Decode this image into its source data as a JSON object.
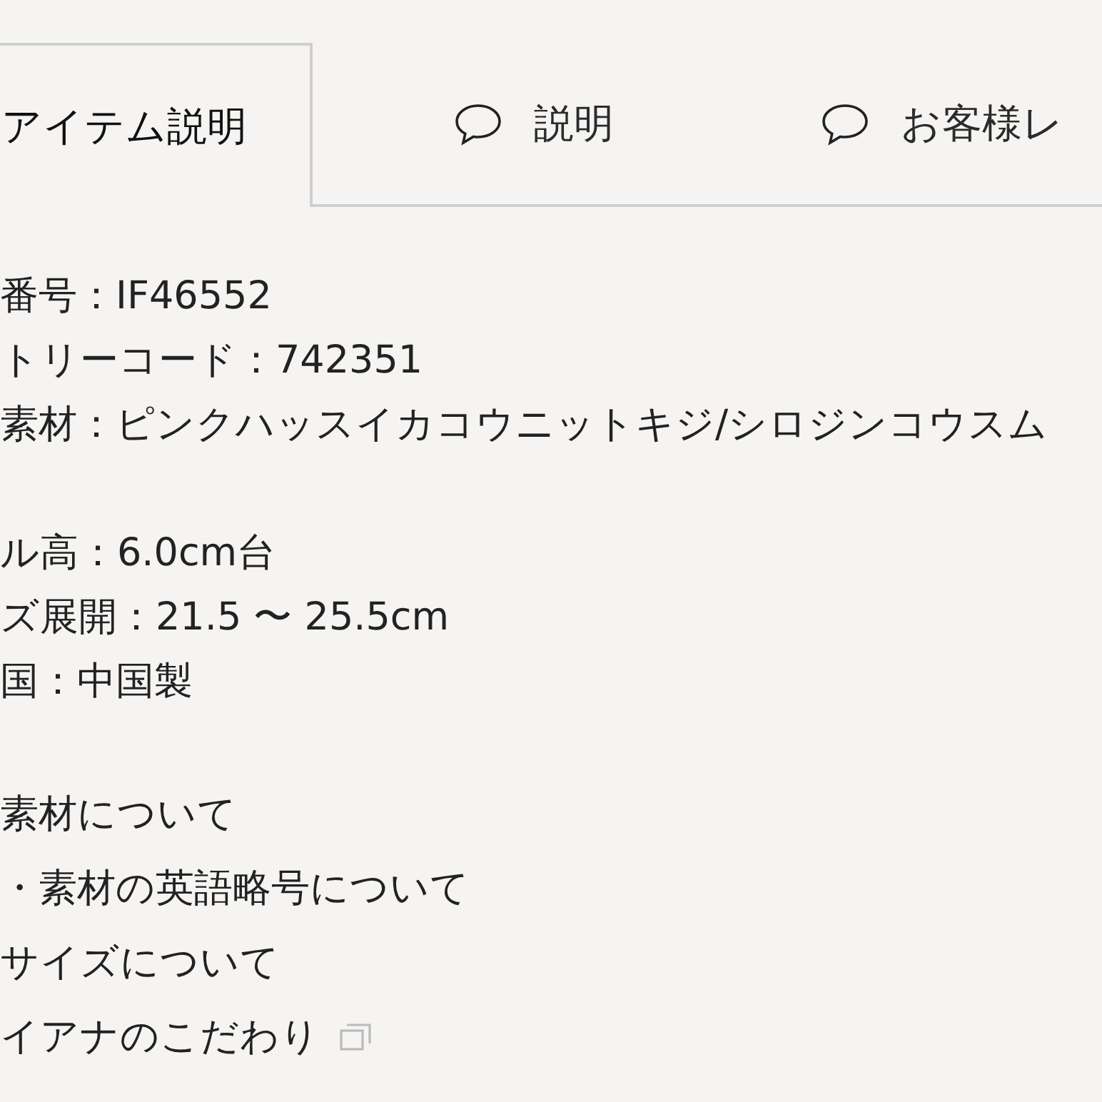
{
  "tabs": [
    {
      "label": "アイテム説明",
      "icon": false,
      "selected": true
    },
    {
      "label": "説明",
      "icon": true,
      "selected": false
    },
    {
      "label": "お客様レ",
      "icon": true,
      "selected": false
    }
  ],
  "detail_groups": [
    [
      "番号：IF46552",
      "トリーコード：742351",
      "素材：ピンクハッスイカコウニットキジ/シロジンコウスム"
    ],
    [
      "ル高：6.0cm台",
      "ズ展開：21.5 〜 25.5cm",
      "国：中国製"
    ]
  ],
  "links": [
    {
      "text": "素材について",
      "external": false
    },
    {
      "text": "・素材の英語略号について",
      "external": false
    },
    {
      "text": "サイズについて",
      "external": false
    },
    {
      "text": "イアナのこだわり",
      "external": true
    }
  ]
}
